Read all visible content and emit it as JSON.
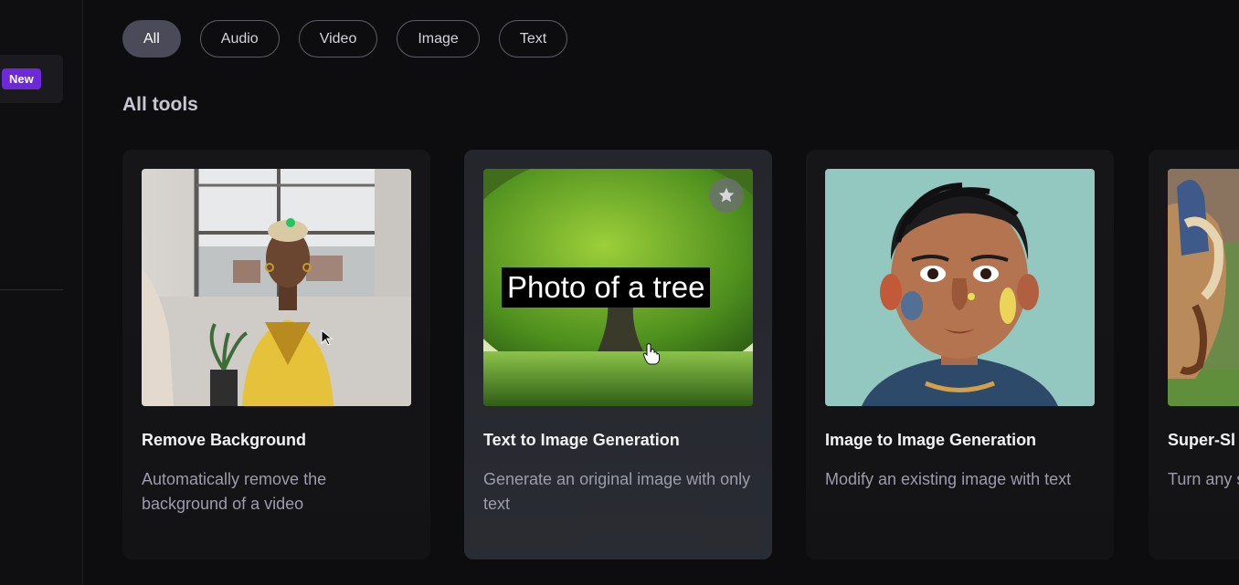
{
  "sidebar": {
    "new_badge": "New"
  },
  "filters": {
    "chips": [
      {
        "label": "All",
        "active": true
      },
      {
        "label": "Audio",
        "active": false
      },
      {
        "label": "Video",
        "active": false
      },
      {
        "label": "Image",
        "active": false
      },
      {
        "label": "Text",
        "active": false
      }
    ]
  },
  "section": {
    "title": "All tools"
  },
  "cards": [
    {
      "title": "Remove Background",
      "description": "Automatically remove the background of a video",
      "thumbnail": "woman-yellow-cardigan-photo"
    },
    {
      "title": "Text to Image Generation",
      "description": "Generate an original image with only text",
      "thumbnail": "tree-photo",
      "overlay_caption": "Photo of a tree",
      "icon": "star-icon"
    },
    {
      "title": "Image to Image Generation",
      "description": "Modify an existing image with text",
      "thumbnail": "boy-pop-art-illustration"
    },
    {
      "title": "Super-Sl",
      "description": "Turn any slow mot",
      "thumbnail": "horse-rider-photo"
    }
  ],
  "colors": {
    "background": "#0d0d0f",
    "badge": "#6d28d9",
    "chip_active": "#4a4a58",
    "card_hover": "#2a2c33"
  }
}
